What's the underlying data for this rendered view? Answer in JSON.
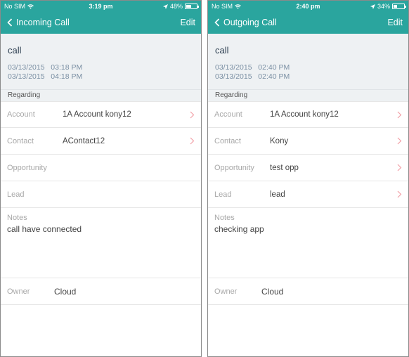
{
  "colors": {
    "header": "#2aa59e",
    "chevron": "#f2a0a8"
  },
  "screens": [
    {
      "status": {
        "carrier": "No SIM",
        "time": "3:19 pm",
        "battery": "48%",
        "battery_level": 0.48
      },
      "nav": {
        "back_label": "Incoming Call",
        "edit_label": "Edit"
      },
      "subject": "call",
      "start": "03/13/2015   03:18 PM",
      "end": "03/13/2015   04:18 PM",
      "regarding_label": "Regarding",
      "account": {
        "label": "Account",
        "value": "1A Account kony12"
      },
      "contact": {
        "label": "Contact",
        "value": "AContact12"
      },
      "opportunity": {
        "label": "Opportunity",
        "value": ""
      },
      "lead": {
        "label": "Lead",
        "value": ""
      },
      "notes": {
        "label": "Notes",
        "value": "call have connected"
      },
      "owner": {
        "label": "Owner",
        "value": "Cloud"
      }
    },
    {
      "status": {
        "carrier": "No SIM",
        "time": "2:40 pm",
        "battery": "34%",
        "battery_level": 0.34
      },
      "nav": {
        "back_label": "Outgoing Call",
        "edit_label": "Edit"
      },
      "subject": "call",
      "start": "03/13/2015   02:40 PM",
      "end": "03/13/2015   02:40 PM",
      "regarding_label": "Regarding",
      "account": {
        "label": "Account",
        "value": "1A Account kony12"
      },
      "contact": {
        "label": "Contact",
        "value": "Kony"
      },
      "opportunity": {
        "label": "Opportunity",
        "value": "test opp"
      },
      "lead": {
        "label": "Lead",
        "value": "lead"
      },
      "notes": {
        "label": "Notes",
        "value": "checking app"
      },
      "owner": {
        "label": "Owner",
        "value": "Cloud"
      }
    }
  ]
}
